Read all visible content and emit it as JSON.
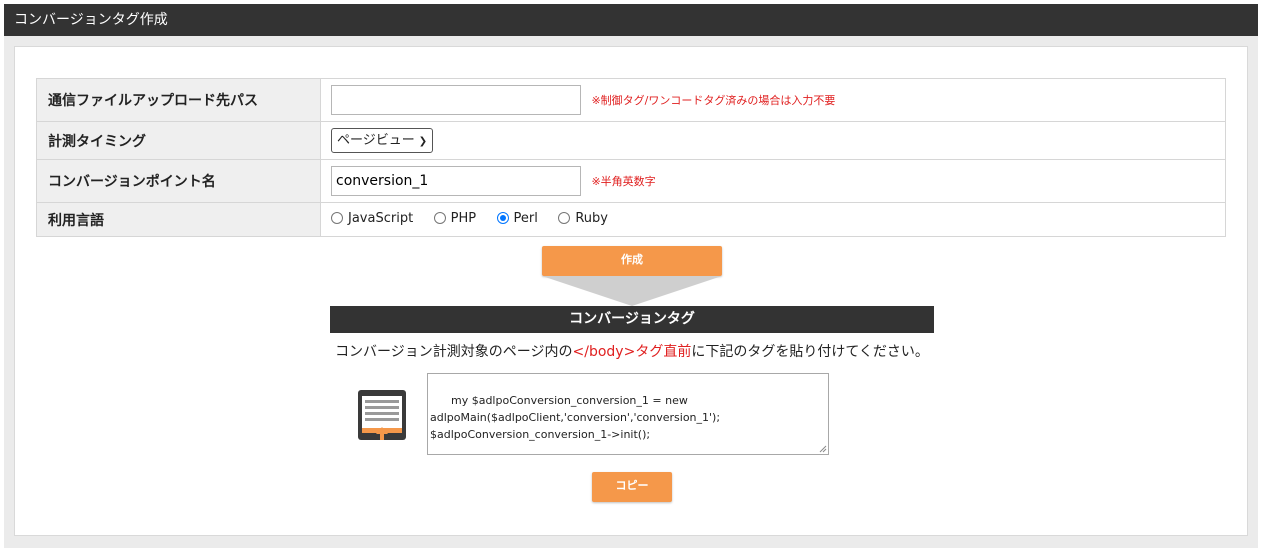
{
  "header": {
    "title": "コンバージョンタグ作成"
  },
  "form": {
    "rows": [
      {
        "label": "通信ファイルアップロード先パス",
        "value": "",
        "note": "※制御タグ/ワンコードタグ済みの場合は入力不要"
      },
      {
        "label": "計測タイミング",
        "select_value": "ページビュー"
      },
      {
        "label": "コンバージョンポイント名",
        "value": "conversion_1",
        "note": "※半角英数字"
      },
      {
        "label": "利用言語",
        "options": [
          "JavaScript",
          "PHP",
          "Perl",
          "Ruby"
        ],
        "selected": "Perl"
      }
    ]
  },
  "buttons": {
    "create": "作成",
    "copy": "コピー"
  },
  "result": {
    "title": "コンバージョンタグ",
    "instruction_pre": "コンバージョン計測対象のページ内の",
    "instruction_highlight": "</body>タグ直前",
    "instruction_post": "に下記のタグを貼り付けてください。",
    "code": "my $adlpoConversion_conversion_1 = new adlpoMain($adlpoClient,'conversion','conversion_1');\n$adlpoConversion_conversion_1->init();"
  },
  "colors": {
    "accent": "#f5984a",
    "header_bg": "#333333",
    "note": "#e02020",
    "radio_on": "#0075ff"
  }
}
